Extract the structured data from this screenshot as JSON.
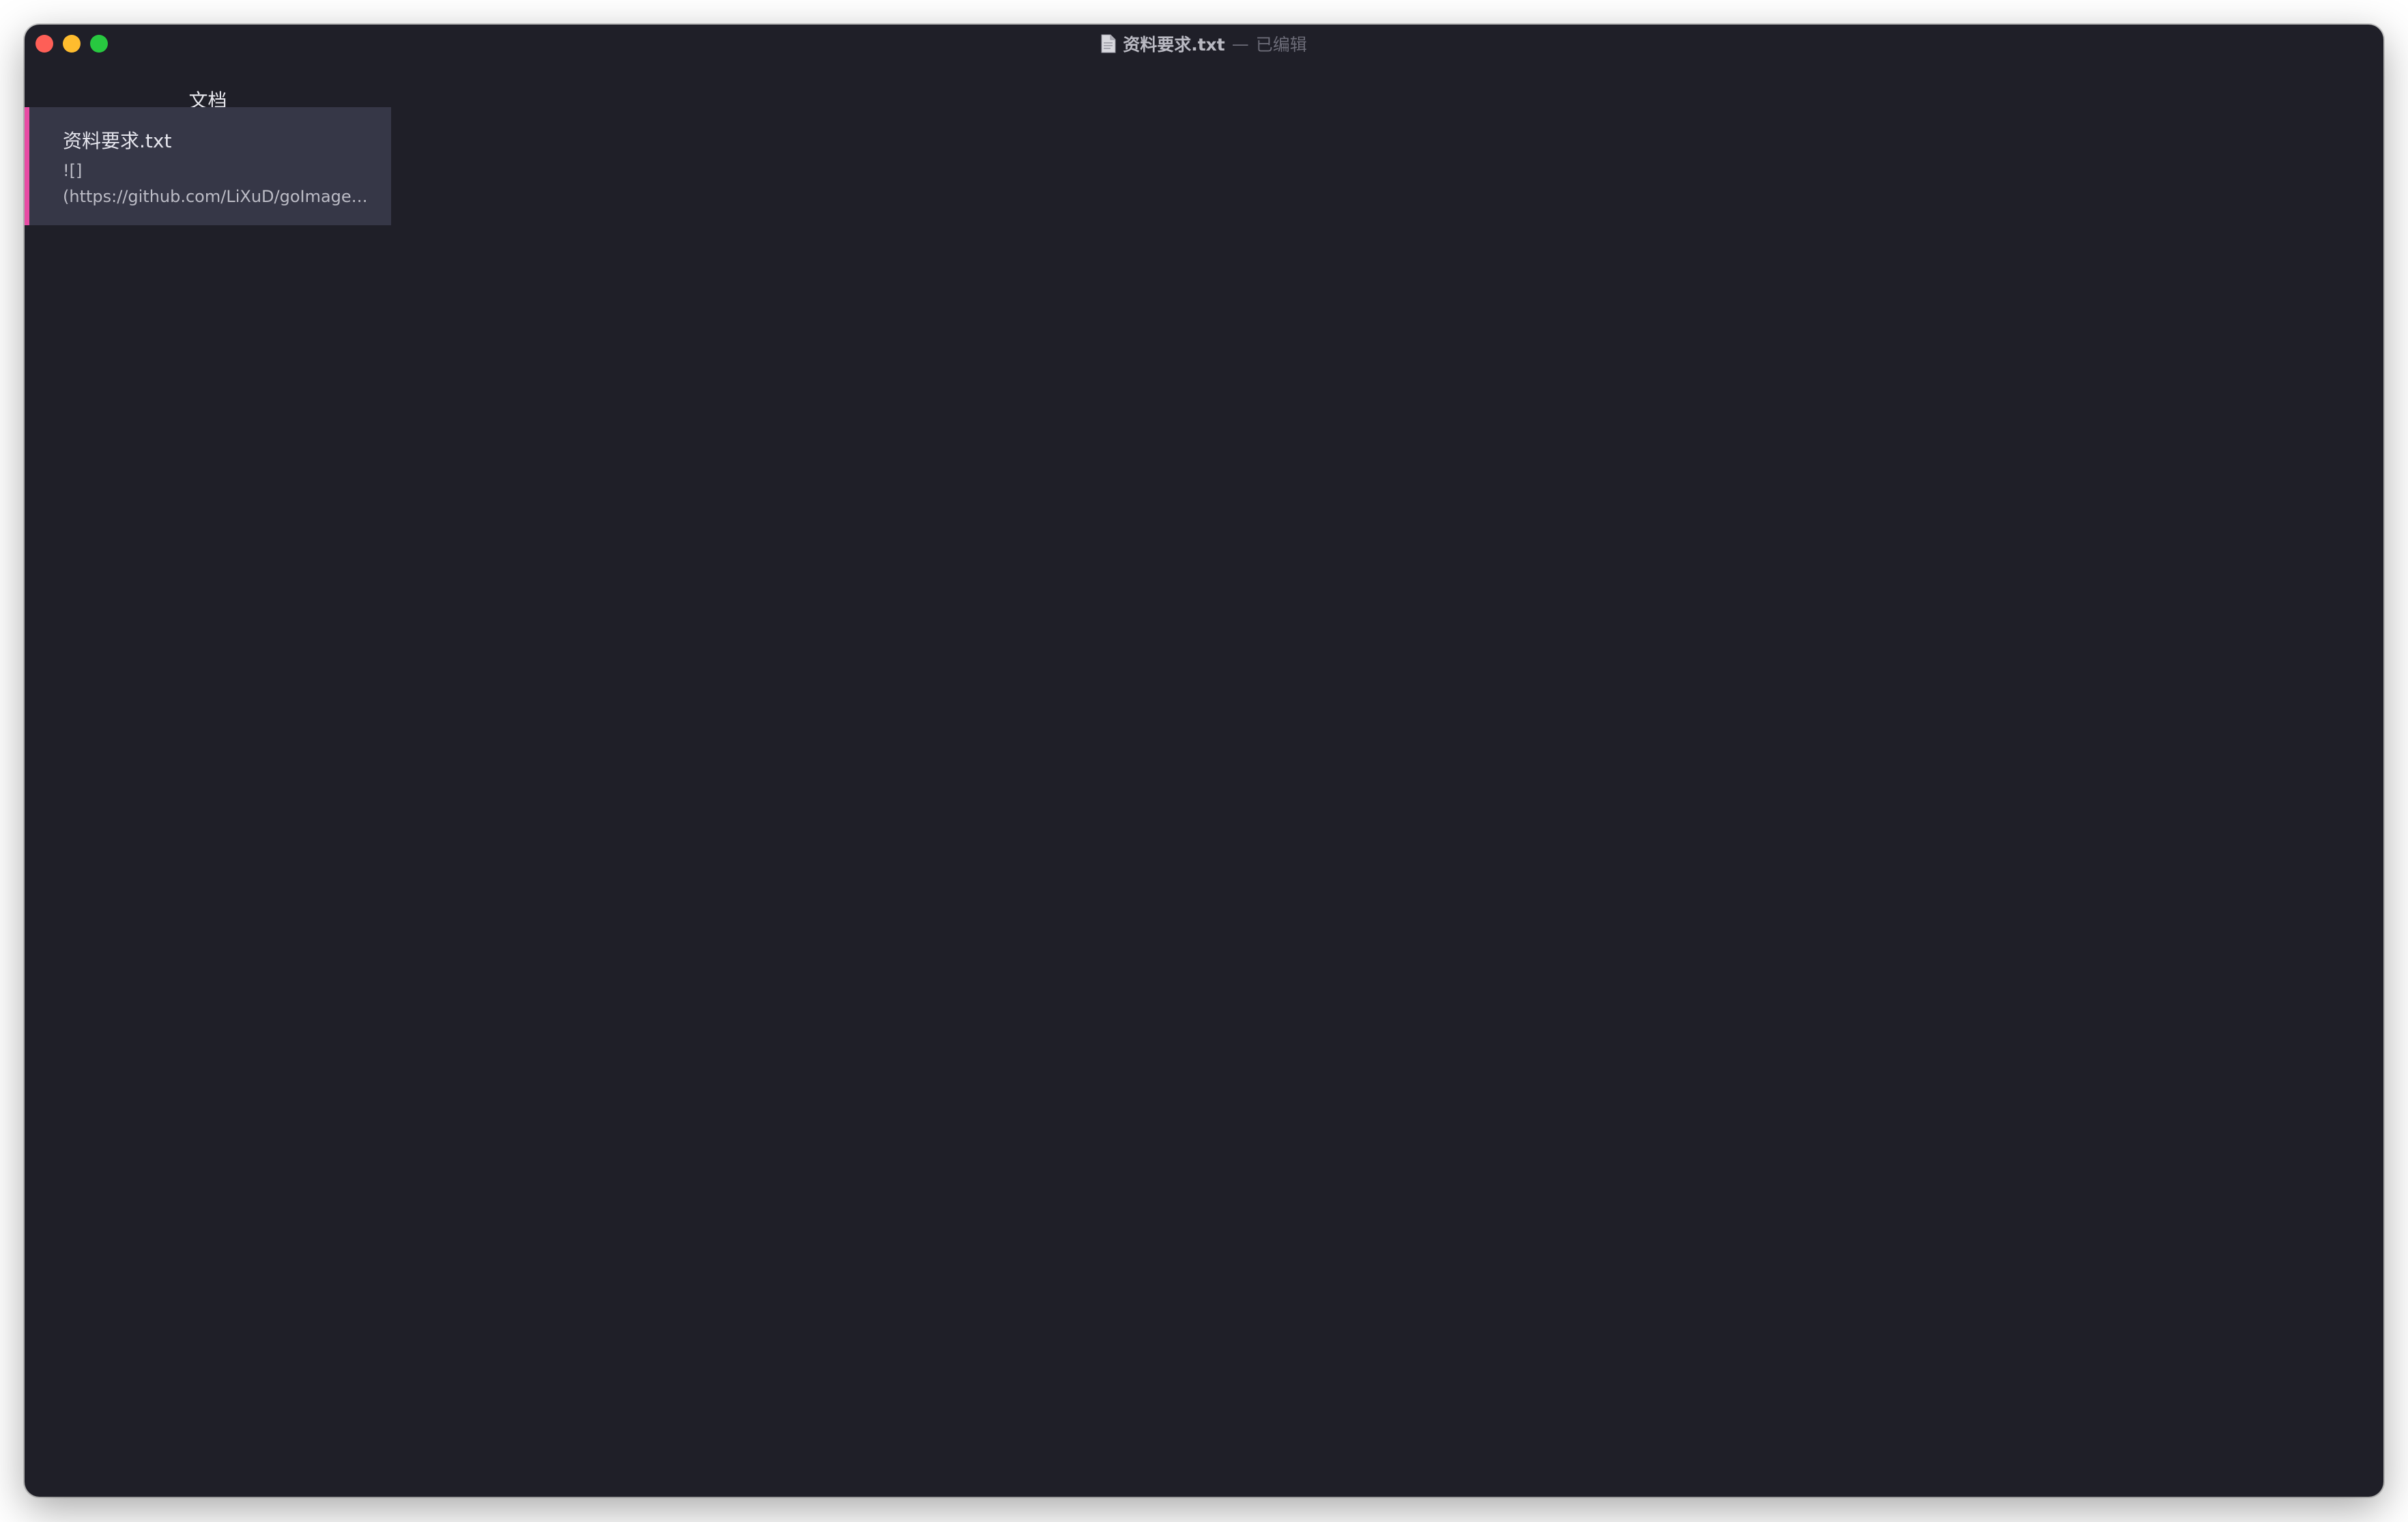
{
  "window": {
    "title": "资料要求.txt",
    "separator": "—",
    "status": "已编辑",
    "colors": {
      "background": "#1f1f28",
      "close": "#fe5f57",
      "minimize": "#febc2e",
      "maximize": "#28c840"
    }
  },
  "titlebar": {
    "doc_icon": "document-icon"
  },
  "sidebar": {
    "header": "文档",
    "items": [
      {
        "title": "资料要求.txt",
        "preview_line1": "![]",
        "preview_line2": "(https://github.com/LiXuD/goImage…",
        "accent_color": "#e84ba4",
        "selected": true
      }
    ]
  }
}
